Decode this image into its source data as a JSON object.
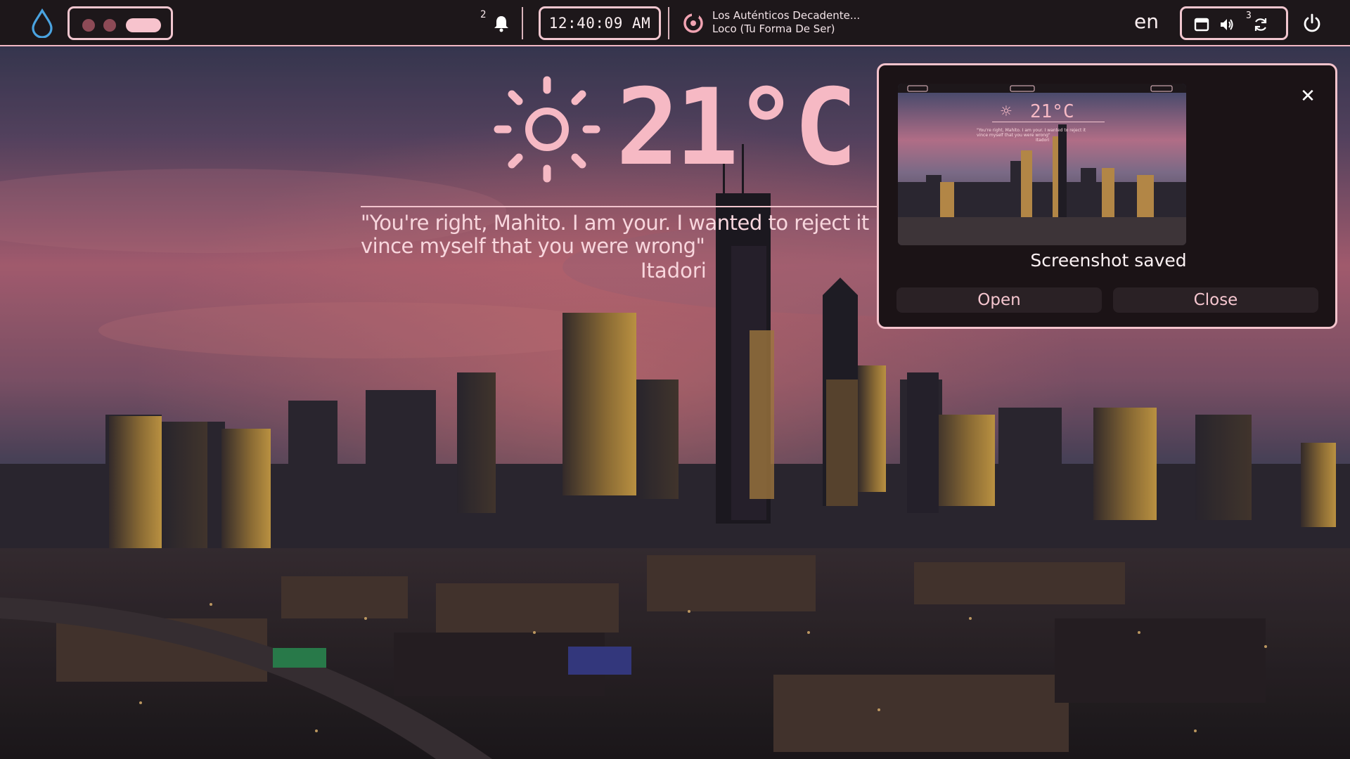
{
  "topbar": {
    "launcher_icon": "droplet-icon",
    "workspaces": {
      "count": 3,
      "active_index": 3
    },
    "notifications": {
      "count": "2",
      "icon": "bell-icon"
    },
    "clock": "12:40:09 AM",
    "media": {
      "icon": "music-disc-icon",
      "line1": "Los Auténticos Decadente...",
      "line2": "Loco (Tu Forma De Ser)"
    },
    "language": "en",
    "systray": {
      "icons": [
        "window-icon",
        "speaker-icon",
        "refresh-icon"
      ],
      "updates_count": "3"
    },
    "power_icon": "power-icon"
  },
  "widget": {
    "weather_icon": "sun-icon",
    "temperature": "21°C",
    "quote_line1": "\"You're right, Mahito. I am your. I wanted to reject it",
    "quote_line2": "vince myself that you were wrong\"",
    "quote_author": "Itadori"
  },
  "notification": {
    "title": "Screenshot saved",
    "open_label": "Open",
    "close_label": "Close",
    "close_icon": "close-icon",
    "thumbnail": {
      "temperature": "21°C",
      "quote_line1": "\"You're right, Mahito. I am your. I wanted to reject it",
      "quote_line2": "vince myself that you were wrong\"",
      "quote_author": "Itadori"
    }
  },
  "colors": {
    "accent": "#f4c3cc",
    "bar_bg": "#1d171a",
    "temp_pink": "#f6b9c4"
  }
}
